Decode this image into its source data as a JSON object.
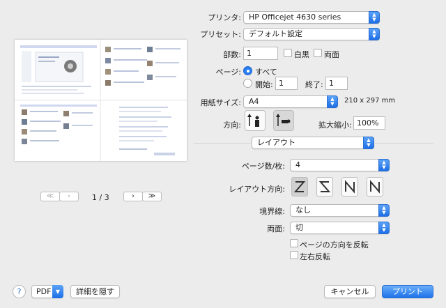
{
  "printer": {
    "label": "プリンタ:",
    "value": "HP Officejet 4630 series"
  },
  "preset": {
    "label": "プリセット:",
    "value": "デフォルト設定"
  },
  "copies": {
    "label": "部数:",
    "value": "1",
    "bw_label": "白黒",
    "duplex_label": "両面"
  },
  "pages": {
    "label": "ページ:",
    "all_label": "すべて",
    "from_label": "開始:",
    "from_value": "1",
    "to_label": "終了:",
    "to_value": "1"
  },
  "paper": {
    "label": "用紙サイズ:",
    "value": "A4",
    "dimensions": "210 x 297 mm"
  },
  "orientation": {
    "label": "方向:"
  },
  "scale": {
    "label": "拡大縮小:",
    "value": "100%"
  },
  "section": {
    "value": "レイアウト"
  },
  "layout": {
    "pages_per_sheet_label": "ページ数/枚:",
    "pages_per_sheet_value": "4",
    "direction_label": "レイアウト方向:",
    "border_label": "境界線:",
    "border_value": "なし",
    "two_sided_label": "両面:",
    "two_sided_value": "切",
    "reverse_orientation_label": "ページの方向を反転",
    "flip_horizontal_label": "左右反転"
  },
  "preview": {
    "page_indicator": "1 / 3"
  },
  "footer": {
    "help": "?",
    "pdf": "PDF",
    "hide_details": "詳細を隠す",
    "cancel": "キャンセル",
    "print": "プリント"
  },
  "colors": {
    "accent": "#2a7ef2",
    "window_bg": "#ececec"
  }
}
